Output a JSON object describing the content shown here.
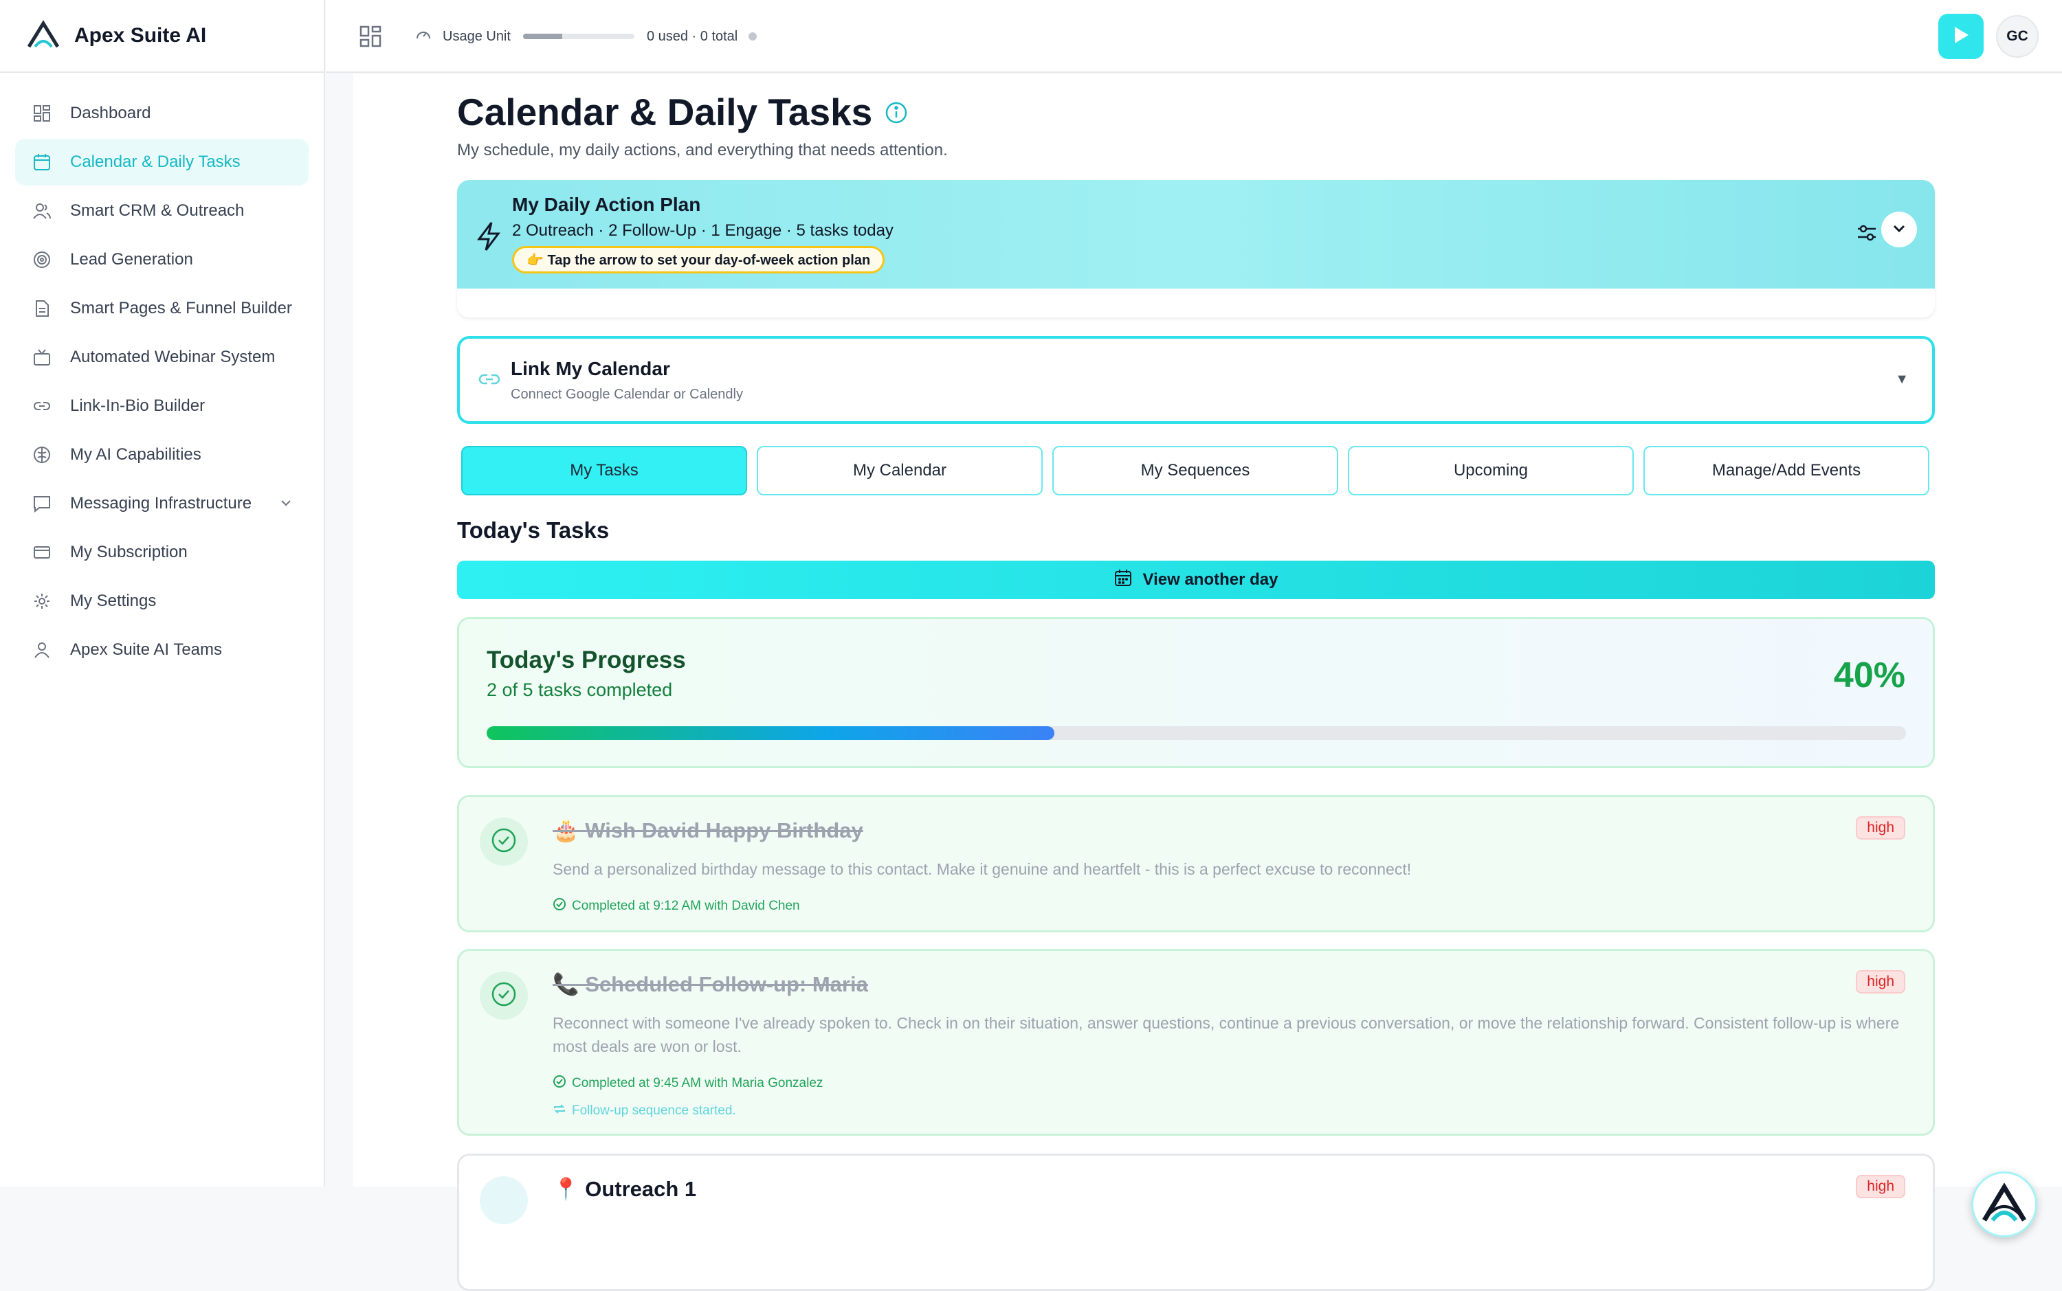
{
  "brand": {
    "name": "Apex Suite AI"
  },
  "sidebar": {
    "items": [
      {
        "label": "Dashboard",
        "icon": "dashboard-icon"
      },
      {
        "label": "Calendar & Daily Tasks",
        "icon": "calendar-icon",
        "active": true
      },
      {
        "label": "Smart CRM & Outreach",
        "icon": "users-icon"
      },
      {
        "label": "Lead Generation",
        "icon": "target-icon"
      },
      {
        "label": "Smart Pages & Funnel Builder",
        "icon": "document-icon"
      },
      {
        "label": "Automated Webinar System",
        "icon": "tv-icon"
      },
      {
        "label": "Link-In-Bio Builder",
        "icon": "link-icon"
      },
      {
        "label": "My AI Capabilities",
        "icon": "brain-icon"
      },
      {
        "label": "Messaging Infrastructure",
        "icon": "message-icon"
      },
      {
        "label": "My Subscription",
        "icon": "card-icon"
      },
      {
        "label": "My Settings",
        "icon": "gear-icon"
      },
      {
        "label": "Apex Suite AI Teams",
        "icon": "team-icon"
      }
    ]
  },
  "topbar": {
    "usage_label": "Usage Unit",
    "usage_text": "0 used · 0 total",
    "usage_fraction": 0.35,
    "avatar_initials": "GC"
  },
  "page": {
    "title": "Calendar & Daily Tasks",
    "subtitle": "My schedule, my daily actions, and everything that needs attention."
  },
  "plan": {
    "title": "My Daily Action Plan",
    "summary": "2 Outreach · 2 Follow-Up · 1 Engage · 5 tasks today",
    "hint": "👉 Tap the arrow to set your day-of-week action plan"
  },
  "link_calendar": {
    "title": "Link My Calendar",
    "subtitle": "Connect Google Calendar or Calendly"
  },
  "tabs": [
    "My Tasks",
    "My Calendar",
    "My Sequences",
    "Upcoming",
    "Manage/Add Events"
  ],
  "today": {
    "section_title": "Today's Tasks",
    "view_another_day": "View another day"
  },
  "progress": {
    "title": "Today's Progress",
    "subtitle": "2 of 5 tasks completed",
    "percent_label": "40%",
    "fraction": 0.4
  },
  "tasks": [
    {
      "title": "🎂 Wish David Happy Birthday",
      "priority": "high",
      "description": "Send a personalized birthday message to this contact. Make it genuine and heartfelt - this is a perfect excuse to reconnect!",
      "completed": "Completed at 9:12 AM with David Chen"
    },
    {
      "title": "📞 Scheduled Follow-up: Maria",
      "priority": "high",
      "description": "Reconnect with someone I've already spoken to. Check in on their situation, answer questions, continue a previous conversation, or move the relationship forward. Consistent follow-up is where most deals are won or lost.",
      "completed": "Completed at 9:45 AM with Maria Gonzalez",
      "sequence": "Follow-up sequence started."
    },
    {
      "title": "📍 Outreach 1",
      "priority": "high"
    }
  ],
  "colors": {
    "accent": "#2ee6ec",
    "success": "#16a34a",
    "danger": "#dc2626"
  }
}
